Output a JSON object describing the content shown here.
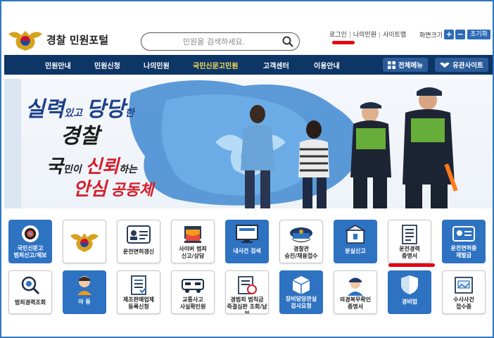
{
  "header": {
    "site_title": "경찰 민원포털",
    "search_placeholder": "민원을 검색하세요.",
    "util_links": [
      "로그인",
      "나의민원",
      "사이트맵"
    ],
    "zoom_label": "화면크기",
    "zoom_plus": "+",
    "zoom_minus": "−",
    "zoom_reset": "초기화"
  },
  "nav": {
    "items": [
      "민원안내",
      "민원신청",
      "나의민원",
      "국민신문고민원",
      "고객센터",
      "이용안내"
    ],
    "all_menu": "전체메뉴",
    "related_sites": "유관사이트"
  },
  "banner": {
    "line1a": "실력",
    "line1b": "있고",
    "line1c": "당당",
    "line1d": "한",
    "line2": "경찰",
    "line3a": "국",
    "line3b": "민이",
    "line3c": "신뢰",
    "line3d": "하는",
    "line4a": "안심",
    "line4b": "공동체"
  },
  "tiles_row1": [
    {
      "label": "국민신문고\n범죄신고/제보",
      "style": "blue",
      "icon": "megaphone-icon"
    },
    {
      "label": "",
      "style": "white",
      "icon": "police-emblem-icon"
    },
    {
      "label": "운전면허갱신",
      "style": "white",
      "icon": "license-card-icon"
    },
    {
      "label": "사이버 범죄\n신고/상담",
      "style": "white",
      "icon": "cyber-shield-icon"
    },
    {
      "label": "내사건 검색",
      "style": "blue",
      "icon": "monitor-search-icon"
    },
    {
      "label": "경찰관\n승진/채용접수",
      "style": "white",
      "icon": "police-cap-icon"
    },
    {
      "label": "분실신고",
      "style": "blue",
      "icon": "lost-box-icon"
    },
    {
      "label": "운전경력\n증명서",
      "style": "white",
      "icon": "document-scroll-icon"
    },
    {
      "label": "운전면허증\n재발급",
      "style": "blue",
      "icon": "license-reissue-icon"
    }
  ],
  "tiles_row2": [
    {
      "label": "범죄경력조회",
      "style": "white",
      "icon": "magnifier-record-icon"
    },
    {
      "label": "아 동",
      "style": "blue",
      "icon": "child-icon"
    },
    {
      "label": "제조판매업체\n등록신청",
      "style": "white",
      "icon": "registration-form-icon"
    },
    {
      "label": "교통사고\n사실확인원",
      "style": "white",
      "icon": "car-accident-icon"
    },
    {
      "label": "경범죄 범칙금\n즉결심판 조회/납부",
      "style": "white",
      "icon": "fine-notice-icon"
    },
    {
      "label": "장비담당관실\n검사요청",
      "style": "blue",
      "icon": "equipment-box-icon"
    },
    {
      "label": "의경복무확인\n증명서",
      "style": "white",
      "icon": "conscript-officer-icon"
    },
    {
      "label": "경비업",
      "style": "blue",
      "icon": "security-shield-icon"
    },
    {
      "label": "수사사건\n접수증",
      "style": "white",
      "icon": "receipt-frame-icon"
    }
  ],
  "colors": {
    "nav_bg": "#0d3566",
    "tile_blue": "#2e72c2",
    "highlight_red": "#e60012",
    "active_nav": "#f5e15a"
  }
}
